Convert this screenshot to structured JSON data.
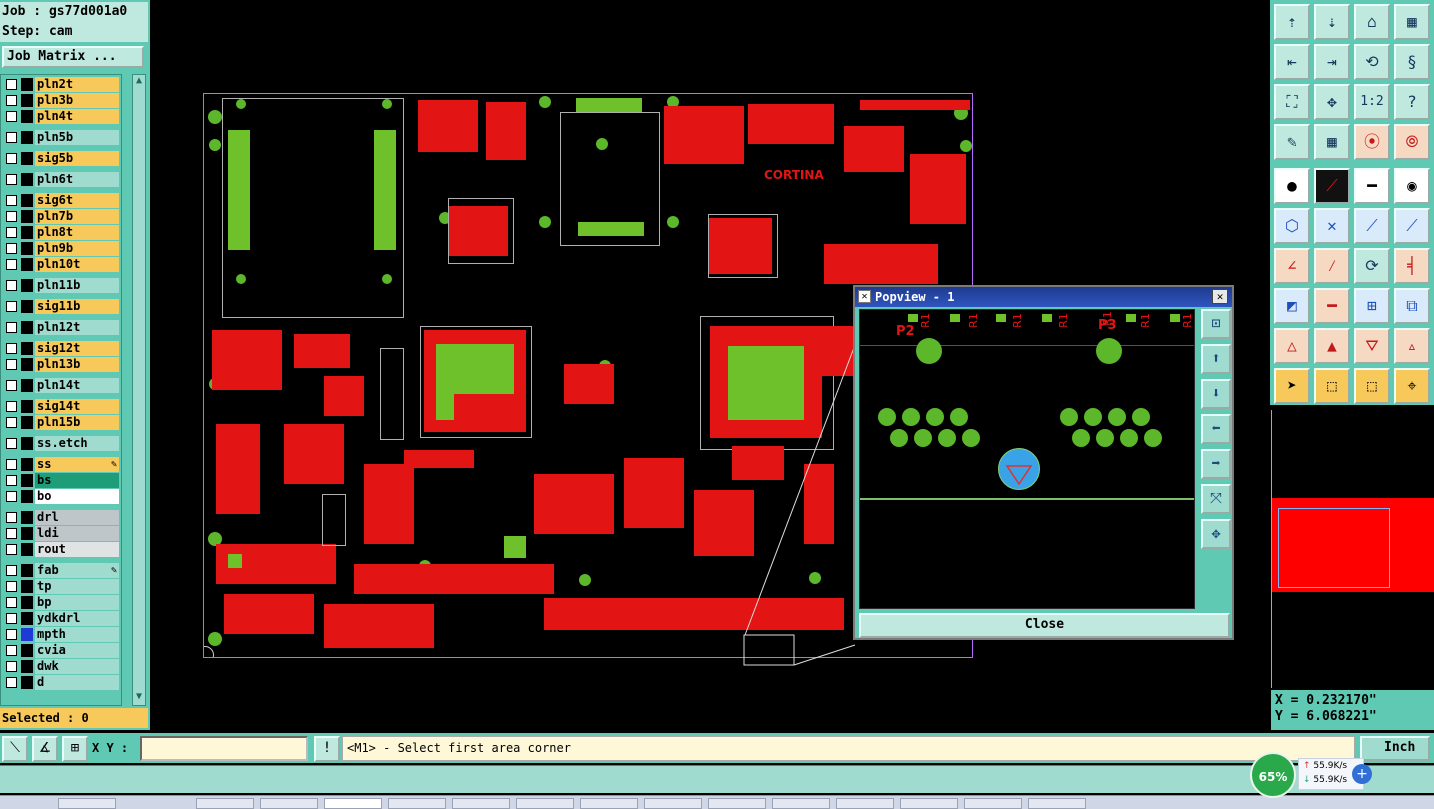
{
  "job": {
    "label": "Job : gs77d001a0",
    "step": "Step: cam"
  },
  "left": {
    "job_matrix_label": "Job Matrix ...",
    "selected_label": "Selected : 0"
  },
  "layers": [
    {
      "name": "pln2t",
      "color": "#f7c85a"
    },
    {
      "name": "pln3b",
      "color": "#f7c85a"
    },
    {
      "name": "pln4t",
      "color": "#f7c85a"
    },
    {
      "name": "pln5b",
      "color": "#9fdccf"
    },
    {
      "name": "sig5b",
      "color": "#f7c85a"
    },
    {
      "name": "pln6t",
      "color": "#9fdccf"
    },
    {
      "name": "sig6t",
      "color": "#f7c85a"
    },
    {
      "name": "pln7b",
      "color": "#f7c85a"
    },
    {
      "name": "pln8t",
      "color": "#f7c85a"
    },
    {
      "name": "pln9b",
      "color": "#f7c85a"
    },
    {
      "name": "pln10t",
      "color": "#f7c85a"
    },
    {
      "name": "pln11b",
      "color": "#9fdccf"
    },
    {
      "name": "sig11b",
      "color": "#f7c85a"
    },
    {
      "name": "pln12t",
      "color": "#9fdccf"
    },
    {
      "name": "sig12t",
      "color": "#f7c85a"
    },
    {
      "name": "pln13b",
      "color": "#f7c85a"
    },
    {
      "name": "pln14t",
      "color": "#9fdccf"
    },
    {
      "name": "sig14t",
      "color": "#f7c85a"
    },
    {
      "name": "pln15b",
      "color": "#f7c85a"
    },
    {
      "name": "ss.etch",
      "color": "#9fdccf"
    },
    {
      "name": "ss",
      "color": "#f7c85a"
    },
    {
      "name": "bs",
      "color": "#1f9c78"
    },
    {
      "name": "bo",
      "color": "#ffffff"
    },
    {
      "name": "drl",
      "color": "#bfc6c9"
    },
    {
      "name": "ldi",
      "color": "#bfc6c9"
    },
    {
      "name": "rout",
      "color": "#dfe3e4"
    },
    {
      "name": "fab",
      "color": "#9fdccf"
    },
    {
      "name": "tp",
      "color": "#9fdccf"
    },
    {
      "name": "bp",
      "color": "#9fdccf"
    },
    {
      "name": "ydkdrl",
      "color": "#9fdccf"
    },
    {
      "name": "mpth",
      "color": "#9fdccf"
    },
    {
      "name": "cvia",
      "color": "#9fdccf"
    },
    {
      "name": "dwk",
      "color": "#9fdccf"
    },
    {
      "name": "d",
      "color": "#9fdccf"
    }
  ],
  "board": {
    "silk_logo": "CORTINA"
  },
  "popview": {
    "title": "Popview - 1",
    "close_label": "Close",
    "labels": [
      "P2",
      "P3"
    ],
    "r_labels": [
      "R1",
      "R1",
      "R1",
      "R1",
      "R1",
      "R1",
      "R1",
      "R1"
    ]
  },
  "coords": {
    "x": "X = 0.232170\"",
    "y": "Y = 6.068221\""
  },
  "bottom": {
    "xy_label": "X Y :",
    "xy_value": "",
    "status": "<M1> - Select first area corner",
    "unit": "Inch"
  },
  "net": {
    "percent": "65%",
    "up": "55.9K/s",
    "down": "55.9K/s"
  },
  "colors": {
    "panel": "#60c9b3",
    "signal": "#e31414",
    "pad": "#6fc12c"
  }
}
